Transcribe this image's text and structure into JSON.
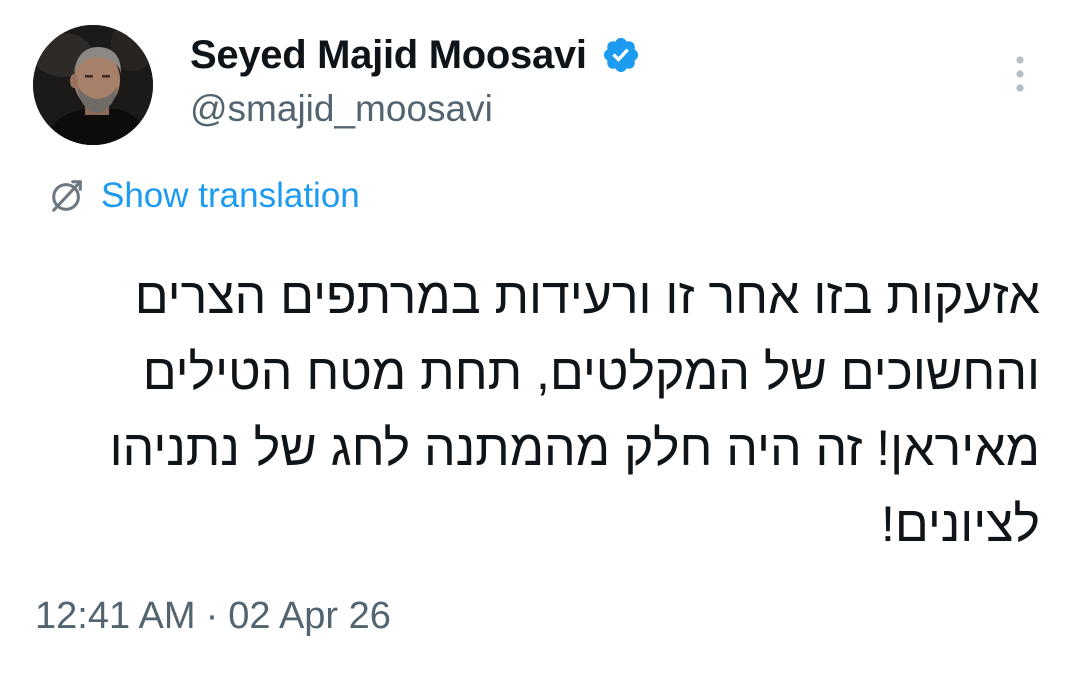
{
  "tweet": {
    "author": {
      "display_name": "Seyed Majid Moosavi",
      "handle": "@smajid_moosavi",
      "verified": true,
      "avatar_icon": "profile-photo"
    },
    "translate_label": "Show translation",
    "text": "אזעקות בזו אחר זו ורעידות במרתפים הצרים\nוהחשוכים של המקלטים, תחת מטח הטילים\nמאיראן! זה היה חלק מהמתנה לחג של נתניהו\nלציונים!",
    "time": "12:41 AM",
    "separator": "·",
    "date": "02 Apr 26"
  },
  "colors": {
    "accent": "#1d9bf0",
    "text_primary": "#0f1419",
    "text_secondary": "#536471",
    "background": "#ffffff"
  },
  "icons": {
    "verified": "verified-badge-icon",
    "more": "more-vertical-icon",
    "translate": "translate-icon"
  }
}
